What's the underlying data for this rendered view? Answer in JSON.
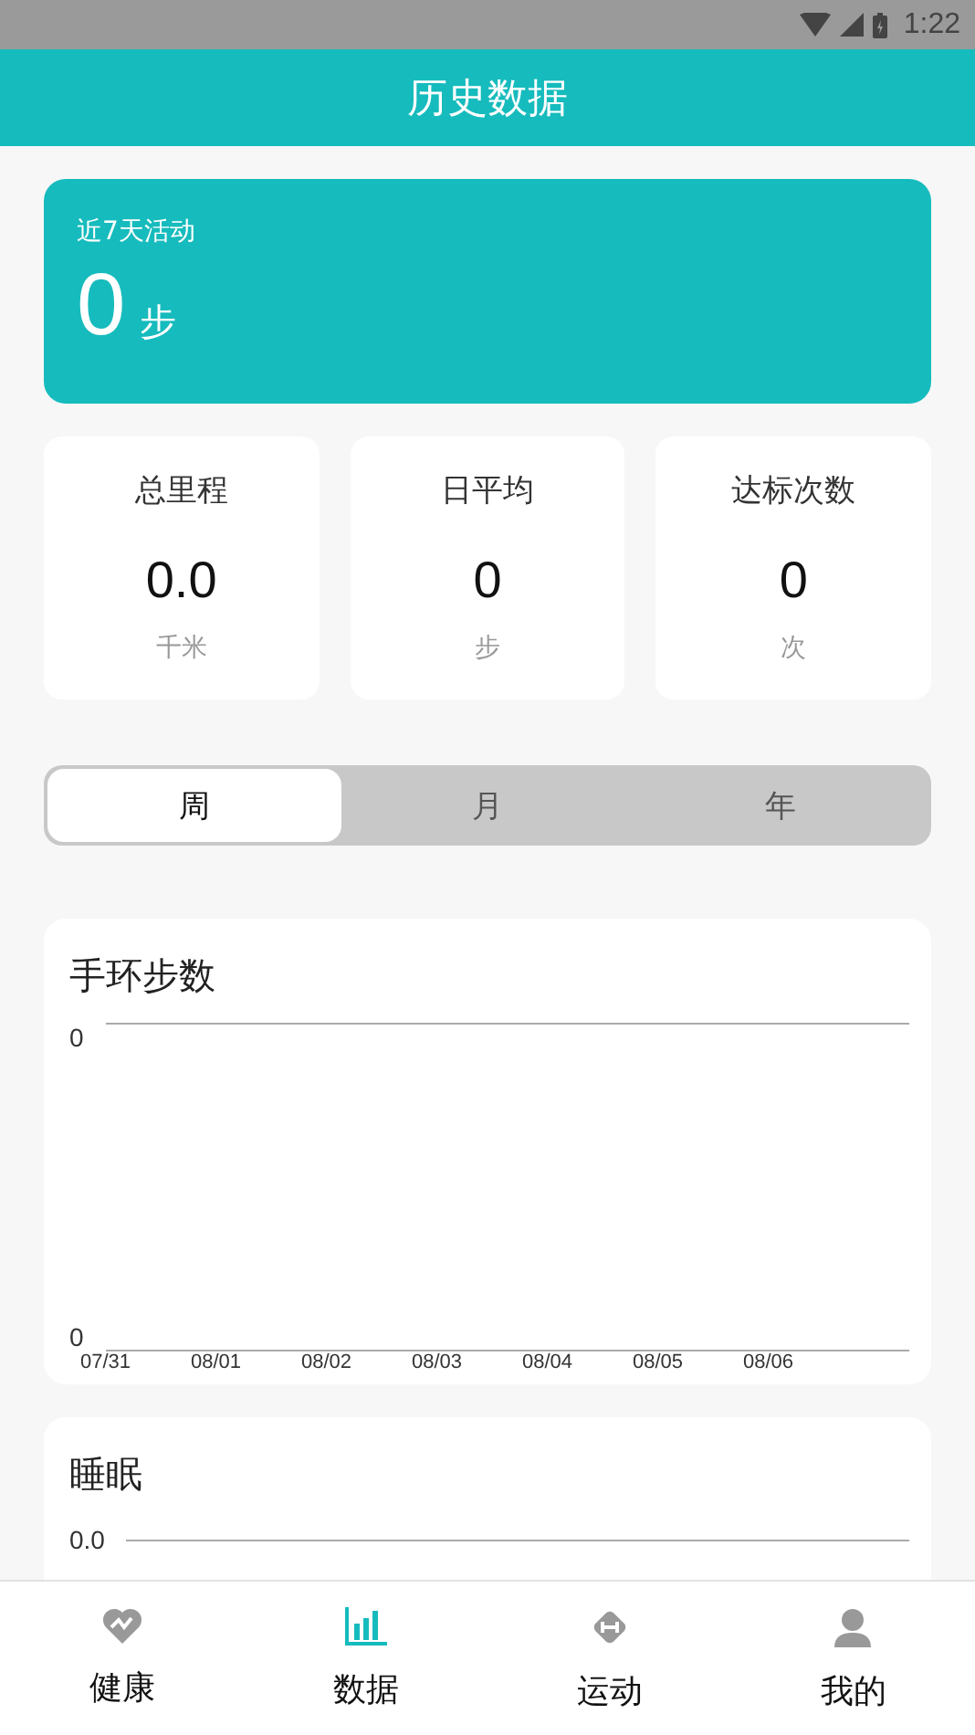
{
  "status_bar": {
    "time": "1:22"
  },
  "header": {
    "title": "历史数据"
  },
  "summary": {
    "label": "近7天活动",
    "value": "0",
    "unit": "步"
  },
  "stats": [
    {
      "label": "总里程",
      "value": "0.0",
      "unit": "千米"
    },
    {
      "label": "日平均",
      "value": "0",
      "unit": "步"
    },
    {
      "label": "达标次数",
      "value": "0",
      "unit": "次"
    }
  ],
  "period_tabs": [
    {
      "label": "周",
      "selected": true
    },
    {
      "label": "月",
      "selected": false
    },
    {
      "label": "年",
      "selected": false
    }
  ],
  "steps_chart": {
    "title": "手环步数",
    "y_labels": [
      "0",
      "0"
    ],
    "x_labels": [
      "07/31",
      "08/01",
      "08/02",
      "08/03",
      "08/04",
      "08/05",
      "08/06"
    ]
  },
  "sleep_chart": {
    "title": "睡眠",
    "y_labels": [
      "0.0"
    ]
  },
  "nav": [
    {
      "label": "健康",
      "kind": "heart",
      "selected": false
    },
    {
      "label": "数据",
      "kind": "chart",
      "selected": true
    },
    {
      "label": "运动",
      "kind": "dumbbell",
      "selected": false
    },
    {
      "label": "我的",
      "kind": "person",
      "selected": false
    }
  ]
}
